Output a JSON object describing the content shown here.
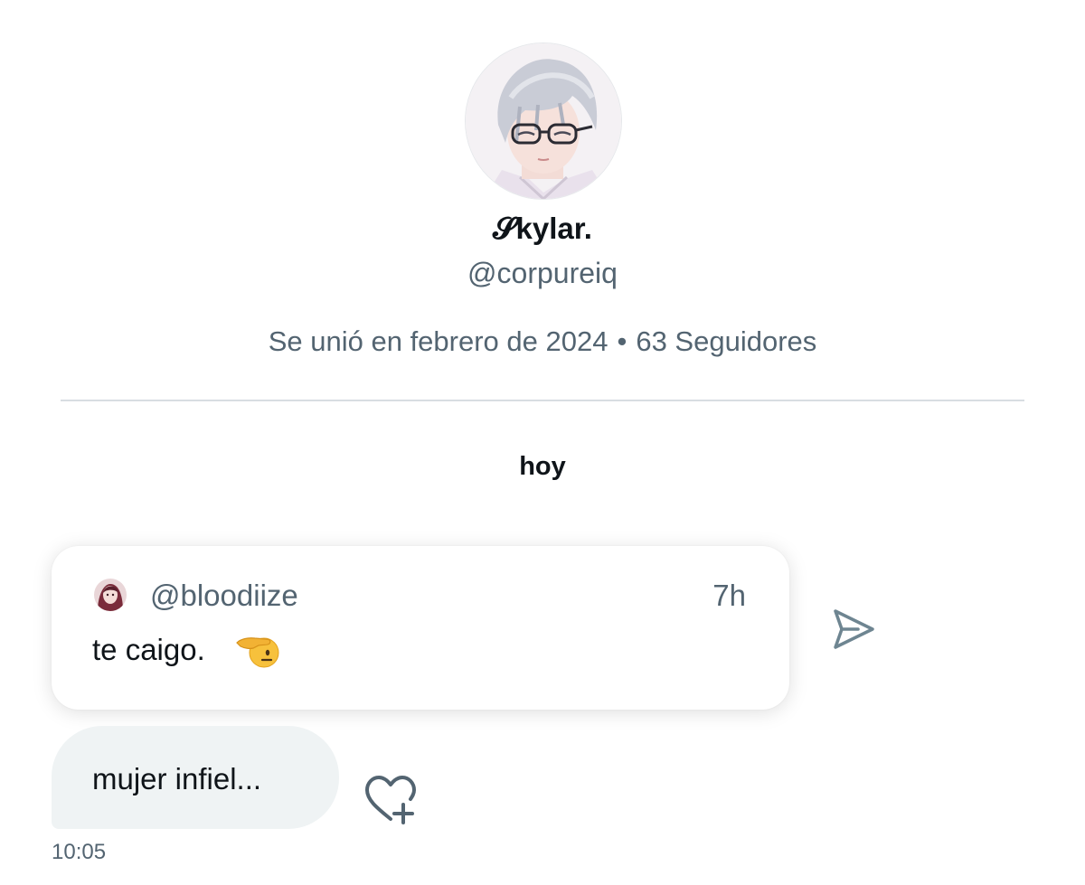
{
  "profile": {
    "display_name": "𝓢kylar.",
    "handle": "@corpureiq",
    "joined": "Se unió en febrero de 2024",
    "separator": "•",
    "followers": "63 Seguidores",
    "avatar_icon": "profile-avatar-image"
  },
  "conversation": {
    "day_label": "hoy"
  },
  "quoted_post": {
    "handle": "@bloodiize",
    "time": "7h",
    "text": "te caigo.",
    "emoji_icon": "saluting-face-emoji",
    "avatar_icon": "quoted-user-avatar"
  },
  "actions": {
    "share_icon": "send-arrow-icon",
    "react_icon": "heart-plus-icon"
  },
  "message": {
    "text": "mujer infiel...",
    "time": "10:05"
  },
  "colors": {
    "text_primary": "#0f1419",
    "text_secondary": "#536471",
    "bubble_bg": "#eff3f4",
    "divider": "#d8dde2",
    "icon": "#536471"
  }
}
